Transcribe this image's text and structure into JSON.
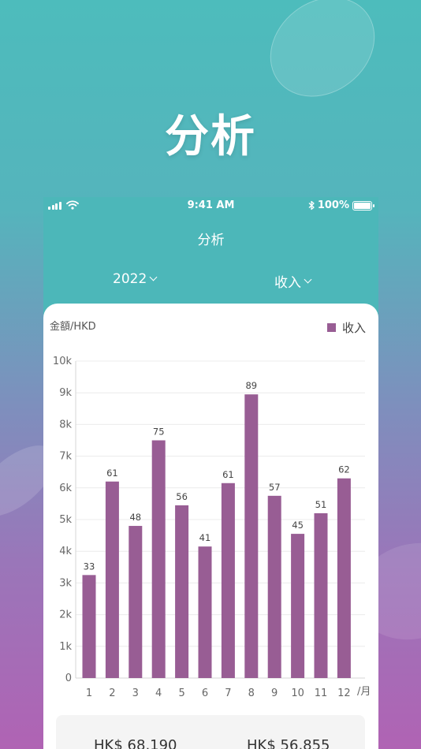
{
  "hero": {
    "title": "分析"
  },
  "status_bar": {
    "time": "9:41 AM",
    "battery": "100%"
  },
  "nav": {
    "title": "分析"
  },
  "filters": {
    "year": "2022",
    "type": "收入"
  },
  "chart_data": {
    "type": "bar",
    "ylabel": "金額/HKD",
    "xlabel": "月",
    "categories": [
      "1",
      "2",
      "3",
      "4",
      "5",
      "6",
      "7",
      "8",
      "9",
      "10",
      "11",
      "12"
    ],
    "series": [
      {
        "name": "收入",
        "values": [
          3250,
          6200,
          4800,
          7500,
          5450,
          4150,
          6150,
          8950,
          5750,
          4550,
          5200,
          6300
        ],
        "labels": [
          "33",
          "61",
          "48",
          "75",
          "56",
          "41",
          "61",
          "89",
          "57",
          "45",
          "51",
          "62"
        ]
      }
    ],
    "ylim": [
      0,
      10000
    ],
    "yticks": [
      "0",
      "1k",
      "2k",
      "3k",
      "4k",
      "5k",
      "6k",
      "7k",
      "8k",
      "9k",
      "10k"
    ],
    "grid": true,
    "legend": "top-right",
    "color": "#985d94"
  },
  "summary": {
    "left": "HK$ 68,190",
    "right": "HK$ 56,855"
  },
  "colors": {
    "teal": "#4cb7b9",
    "bar": "#985d94"
  }
}
